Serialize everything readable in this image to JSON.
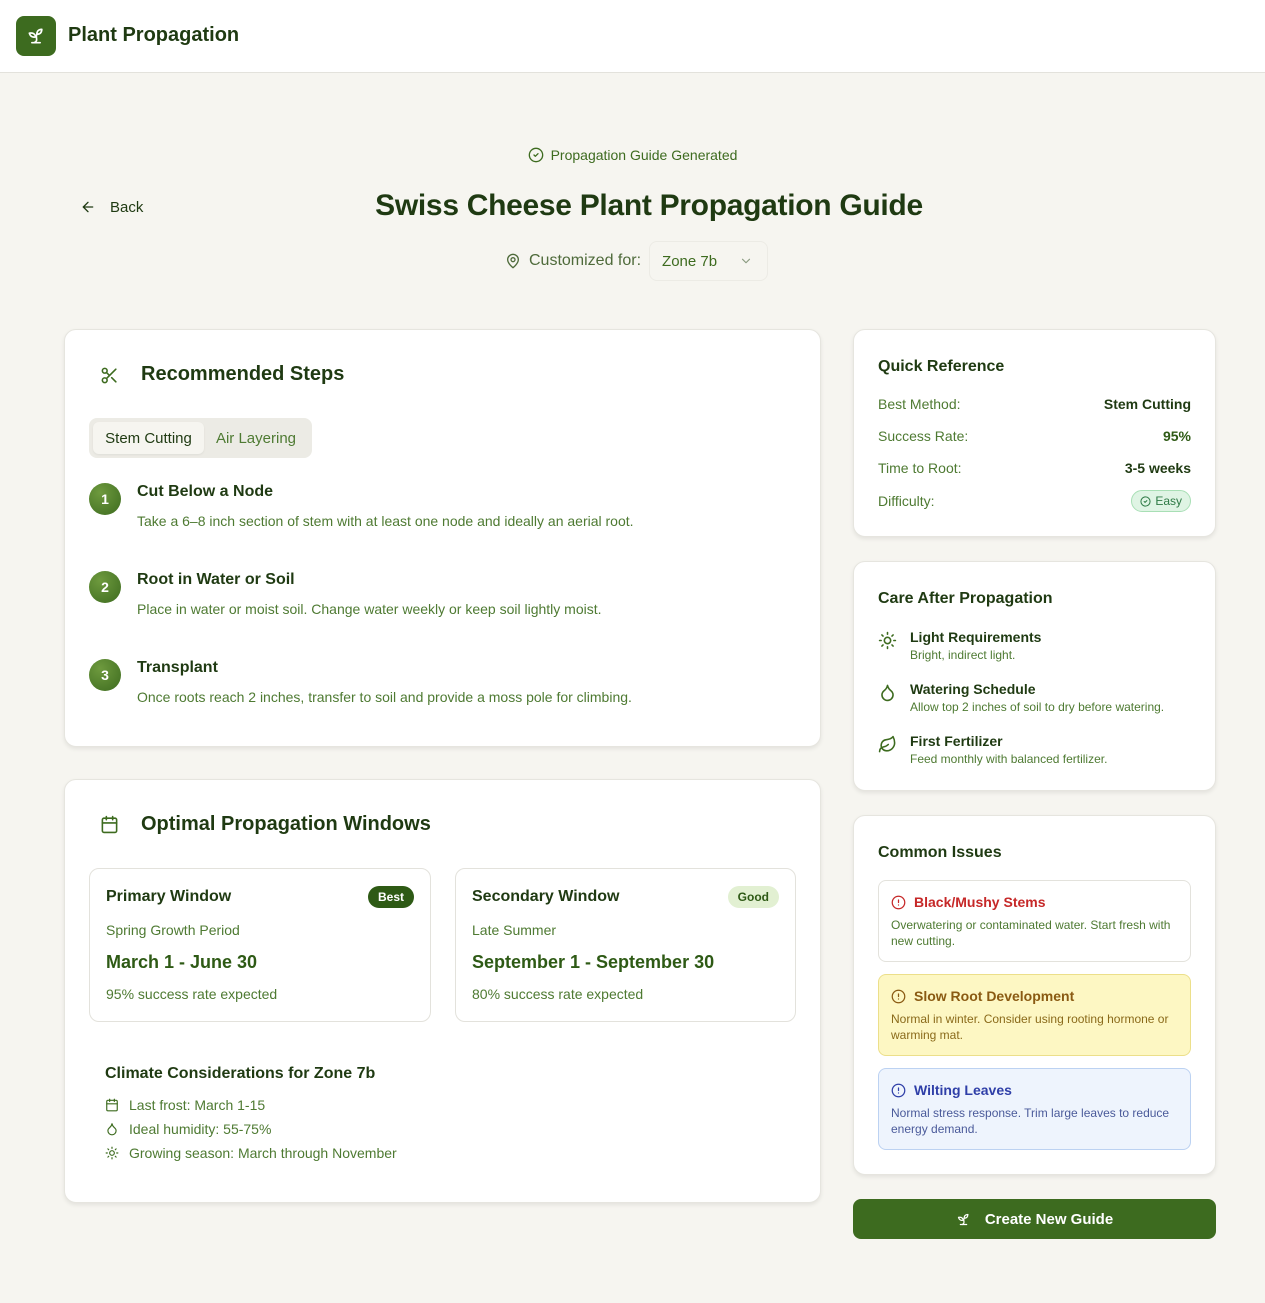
{
  "app": {
    "title": "Plant Propagation",
    "logo_icon": "sprout-icon"
  },
  "hero": {
    "status_text": "Propagation Guide Generated",
    "back_label": "Back",
    "title": "Swiss Cheese Plant Propagation Guide",
    "customized_label": "Customized for:",
    "zone_value": "Zone 7b"
  },
  "steps_card": {
    "title": "Recommended Steps",
    "tabs": [
      {
        "label": "Stem Cutting",
        "active": true
      },
      {
        "label": "Air Layering",
        "active": false
      }
    ],
    "steps": [
      {
        "num": "1",
        "title": "Cut Below a Node",
        "desc": "Take a 6–8 inch section of stem with at least one node and ideally an aerial root."
      },
      {
        "num": "2",
        "title": "Root in Water or Soil",
        "desc": "Place in water or moist soil. Change water weekly or keep soil lightly moist."
      },
      {
        "num": "3",
        "title": "Transplant",
        "desc": "Once roots reach 2 inches, transfer to soil and provide a moss pole for climbing."
      }
    ]
  },
  "windows_card": {
    "title": "Optimal Propagation Windows",
    "windows": [
      {
        "title": "Primary Window",
        "badge": "Best",
        "subtitle": "Spring Growth Period",
        "dates": "March 1 - June 30",
        "rate": "95% success rate expected"
      },
      {
        "title": "Secondary Window",
        "badge": "Good",
        "subtitle": "Late Summer",
        "dates": "September 1 - September 30",
        "rate": "80% success rate expected"
      }
    ],
    "climate_title": "Climate Considerations for Zone 7b",
    "climate_items": [
      {
        "icon": "calendar-icon",
        "text": "Last frost: March 1-15"
      },
      {
        "icon": "droplet-icon",
        "text": "Ideal humidity: 55-75%"
      },
      {
        "icon": "sun-icon",
        "text": "Growing season: March through November"
      }
    ]
  },
  "quick_reference": {
    "title": "Quick Reference",
    "rows": [
      {
        "label": "Best Method:",
        "value": "Stem Cutting"
      },
      {
        "label": "Success Rate:",
        "value": "95%"
      },
      {
        "label": "Time to Root:",
        "value": "3-5 weeks"
      },
      {
        "label": "Difficulty:",
        "value": "Easy"
      }
    ]
  },
  "care": {
    "title": "Care After Propagation",
    "items": [
      {
        "icon": "sun-icon",
        "title": "Light Requirements",
        "desc": "Bright, indirect light."
      },
      {
        "icon": "droplet-icon",
        "title": "Watering Schedule",
        "desc": "Allow top 2 inches of soil to dry before watering."
      },
      {
        "icon": "leaf-icon",
        "title": "First Fertilizer",
        "desc": "Feed monthly with balanced fertilizer."
      }
    ]
  },
  "issues": {
    "title": "Common Issues",
    "items": [
      {
        "title": "Black/Mushy Stems",
        "desc": "Overwatering or contaminated water. Start fresh with new cutting.",
        "severity": "high"
      },
      {
        "title": "Slow Root Development",
        "desc": "Normal in winter. Consider using rooting hormone or warming mat.",
        "severity": "medium"
      },
      {
        "title": "Wilting Leaves",
        "desc": "Normal stress response. Trim large leaves to reduce energy demand.",
        "severity": "info"
      }
    ]
  },
  "create_button": {
    "label": "Create New Guide"
  },
  "colors": {
    "brand": "#3d6b1f",
    "background": "#f6f5f0",
    "danger": "#c62828",
    "warning": "#8a5a12",
    "info": "#2f3fa8"
  }
}
